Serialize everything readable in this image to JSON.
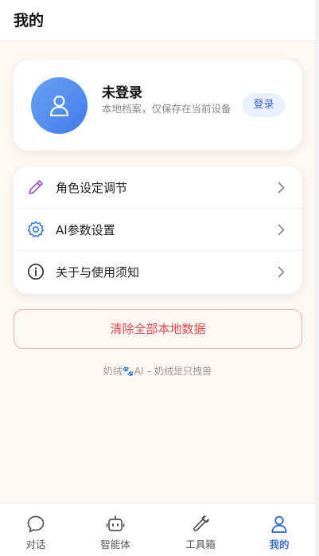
{
  "header": {
    "title": "我的"
  },
  "profile": {
    "avatar_icon": "user-icon",
    "name": "未登录",
    "description": "本地档案，仅保存在当前设备",
    "login_label": "登录"
  },
  "menu": {
    "items": [
      {
        "icon": "pencil-icon",
        "label": "角色设定调节"
      },
      {
        "icon": "gear-icon",
        "label": "AI参数设置"
      },
      {
        "icon": "info-icon",
        "label": "关于与使用须知"
      }
    ]
  },
  "clear_data_label": "清除全部本地数据",
  "footer": {
    "prefix": "奶绒",
    "paw": "🐾",
    "suffix": "AI – 奶绒是只拽兽"
  },
  "tabbar": {
    "active": "我的",
    "tabs": [
      {
        "icon": "chat-bubble-icon",
        "label": "对话"
      },
      {
        "icon": "robot-icon",
        "label": "智能体"
      },
      {
        "icon": "wrench-icon",
        "label": "工具箱"
      },
      {
        "icon": "user-icon",
        "label": "我的"
      }
    ]
  },
  "colors": {
    "accent": "#3f6fd8",
    "page_background": "#fdf7f3",
    "danger": "#e24b4b",
    "pencil": "#9b59d0",
    "gear": "#3d7bd6"
  }
}
